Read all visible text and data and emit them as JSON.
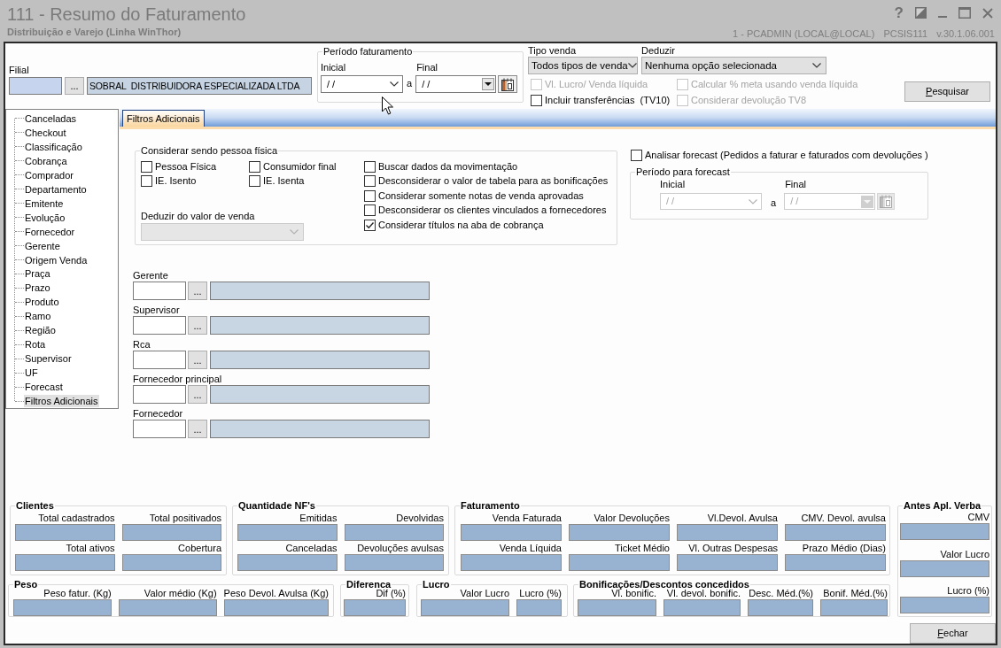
{
  "window": {
    "title": "111 - Resumo do Faturamento",
    "subtitle": "Distribuição e Varejo (Linha WinThor)",
    "help": "?",
    "session": "1 - PCADMIN (LOCAL@LOCAL)",
    "program": "PCSIS111",
    "version": "v.30.1.06.001"
  },
  "filial": {
    "label": "Filial",
    "lookup_button": "...",
    "name": "SOBRAL  DISTRIBUIDORA ESPECIALIZADA LTDA"
  },
  "periodo_faturamento": {
    "title": "Período faturamento",
    "start": {
      "label": "Inicial",
      "value": "/ /"
    },
    "separator": "a",
    "end": {
      "label": "Final",
      "value": "/ /"
    }
  },
  "tipo_venda": {
    "label": "Tipo venda",
    "value": "Todos tipos de venda"
  },
  "deduzir": {
    "label": "Deduzir",
    "value": "Nenhuma opção selecionada"
  },
  "options": [
    {
      "label": "Vl. Lucro/ Venda líquida",
      "checked": false,
      "disabled": true
    },
    {
      "label": "Calcular % meta usando venda líquida",
      "checked": false,
      "disabled": true
    },
    {
      "label": "Incluir transferências  (TV10)",
      "checked": false,
      "disabled": false
    },
    {
      "label": "Considerar devolução TV8",
      "checked": false,
      "disabled": true
    }
  ],
  "search_button": "Pesquisar",
  "sidebar": {
    "items": [
      {
        "label": "Canceladas",
        "selected": false
      },
      {
        "label": "Checkout",
        "selected": false
      },
      {
        "label": "Classificação",
        "selected": false
      },
      {
        "label": "Cobrança",
        "selected": false
      },
      {
        "label": "Comprador",
        "selected": false
      },
      {
        "label": "Departamento",
        "selected": false
      },
      {
        "label": "Emitente",
        "selected": false
      },
      {
        "label": "Evolução",
        "selected": false
      },
      {
        "label": "Fornecedor",
        "selected": false
      },
      {
        "label": "Gerente",
        "selected": false
      },
      {
        "label": "Origem Venda",
        "selected": false
      },
      {
        "label": "Praça",
        "selected": false
      },
      {
        "label": "Prazo",
        "selected": false
      },
      {
        "label": "Produto",
        "selected": false
      },
      {
        "label": "Ramo",
        "selected": false
      },
      {
        "label": "Região",
        "selected": false
      },
      {
        "label": "Rota",
        "selected": false
      },
      {
        "label": "Supervisor",
        "selected": false
      },
      {
        "label": "UF",
        "selected": false
      },
      {
        "label": "Forecast",
        "selected": false
      },
      {
        "label": "Filtros Adicionais",
        "selected": true
      }
    ]
  },
  "tabs": [
    {
      "label": "Filtros Adicionais",
      "selected": true
    }
  ],
  "pessoa_fisica": {
    "title": "Considerar sendo pessoa física",
    "options": [
      {
        "label": "Pessoa Física",
        "checked": false
      },
      {
        "label": "Consumidor final",
        "checked": false
      },
      {
        "label": "IE. Isento",
        "checked": false
      },
      {
        "label": "IE. Isenta",
        "checked": false
      }
    ],
    "deduzir_label": "Deduzir do valor de venda",
    "deduzir_disabled": true,
    "filters": [
      {
        "label": "Buscar dados da movimentação",
        "checked": false
      },
      {
        "label": "Desconsiderar o valor de tabela para as bonificações",
        "checked": false
      },
      {
        "label": "Considerar somente notas de venda aprovadas",
        "checked": false
      },
      {
        "label": "Desconsiderar os clientes vinculados a fornecedores",
        "checked": false
      },
      {
        "label": "Considerar títulos na aba de cobrança",
        "checked": true
      }
    ]
  },
  "forecast": {
    "label": "Analisar forecast (Pedidos a faturar e faturados com devoluções )",
    "checked": false,
    "period": {
      "title": "Período para forecast",
      "disabled": true,
      "start": {
        "label": "Inicial",
        "value": "/ /"
      },
      "separator": "a",
      "end": {
        "label": "Final",
        "value": "/ /"
      }
    }
  },
  "lookups": [
    {
      "label": "Gerente",
      "button": "..."
    },
    {
      "label": "Supervisor",
      "button": "..."
    },
    {
      "label": "Rca",
      "button": "..."
    },
    {
      "label": "Fornecedor principal",
      "button": "..."
    },
    {
      "label": "Fornecedor",
      "button": "..."
    }
  ],
  "summary": {
    "rows": [
      [
        {
          "title": "Clientes",
          "rows": [
            [
              "Total cadastrados",
              "Total positivados"
            ],
            [
              "Total ativos",
              "Cobertura"
            ]
          ]
        },
        {
          "title": "Quantidade NF's",
          "rows": [
            [
              "Emitidas",
              "Devolvidas"
            ],
            [
              "Canceladas",
              "Devoluções avulsas"
            ]
          ]
        },
        {
          "title": "Faturamento",
          "rows": [
            [
              "Venda Faturada",
              "Valor Devoluções",
              "Vl.Devol. Avulsa",
              "CMV. Devol. avulsa"
            ],
            [
              "Venda Líquida",
              "Ticket Médio",
              "Vl. Outras Despesas",
              "Prazo Médio (Dias)"
            ]
          ]
        }
      ],
      [
        {
          "title": "Peso",
          "rows": [
            [
              "Peso fatur. (Kg)",
              "Valor médio (Kg)",
              "Peso Devol. Avulsa (Kg)"
            ]
          ]
        },
        {
          "title": "Diferenca",
          "rows": [
            [
              "Dif (%)"
            ]
          ]
        },
        {
          "title": "Lucro",
          "rows": [
            [
              "Valor Lucro",
              "Lucro (%)"
            ]
          ]
        },
        {
          "title": "Bonificações/Descontos concedidos",
          "rows": [
            [
              "Vl. bonific.",
              "Vl. devol. bonific.",
              "Desc. Méd.(%)",
              "Bonif. Méd.(%)"
            ]
          ]
        }
      ]
    ],
    "side_group": {
      "title": "Antes Apl. Verba",
      "rows": [
        [
          "CMV"
        ],
        [
          "Valor Lucro"
        ],
        [
          "Lucro (%)"
        ]
      ]
    }
  },
  "close_button": "Fechar"
}
